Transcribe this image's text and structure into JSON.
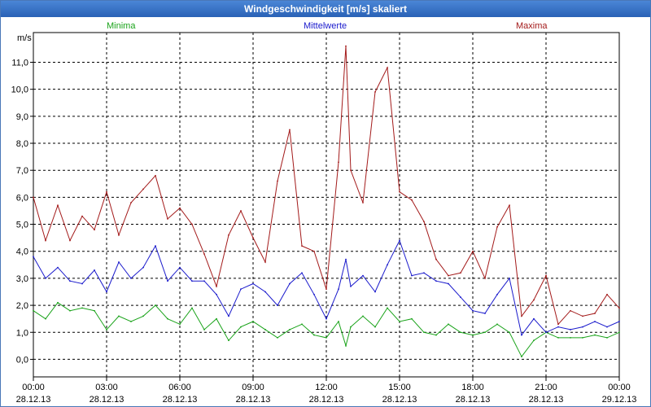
{
  "window": {
    "title": "Windgeschwindigkeit [m/s] skaliert"
  },
  "colors": {
    "minima": "#1aa31a",
    "mittelwerte": "#1a1acc",
    "maxima": "#a31a1a",
    "grid": "#000000"
  },
  "chart_data": {
    "type": "line",
    "title": "Windgeschwindigkeit [m/s] skaliert",
    "ylabel": "m/s",
    "ylim": [
      -0.65,
      12.1
    ],
    "yticks": [
      "0,0",
      "1,0",
      "2,0",
      "3,0",
      "4,0",
      "5,0",
      "6,0",
      "7,0",
      "8,0",
      "9,0",
      "10,0",
      "11,0"
    ],
    "ytick_values": [
      0,
      1,
      2,
      3,
      4,
      5,
      6,
      7,
      8,
      9,
      10,
      11
    ],
    "xlim": [
      0,
      24
    ],
    "xticks": [
      {
        "time": "00:00",
        "date": "28.12.13"
      },
      {
        "time": "03:00",
        "date": "28.12.13"
      },
      {
        "time": "06:00",
        "date": "28.12.13"
      },
      {
        "time": "09:00",
        "date": "28.12.13"
      },
      {
        "time": "12:00",
        "date": "28.12.13"
      },
      {
        "time": "15:00",
        "date": "28.12.13"
      },
      {
        "time": "18:00",
        "date": "28.12.13"
      },
      {
        "time": "21:00",
        "date": "28.12.13"
      },
      {
        "time": "00:00",
        "date": "29.12.13"
      }
    ],
    "grid": true,
    "legend_position": "top",
    "series": [
      {
        "name": "Minima",
        "key": "minima",
        "x": [
          0,
          0.5,
          1,
          1.5,
          2,
          2.5,
          3,
          3.5,
          4,
          4.5,
          5,
          5.5,
          6,
          6.5,
          7,
          7.5,
          8,
          8.5,
          9,
          9.5,
          10,
          10.5,
          11,
          11.5,
          12,
          12.5,
          12.8,
          13,
          13.5,
          14,
          14.5,
          15,
          15.5,
          16,
          16.5,
          17,
          17.5,
          18,
          18.5,
          19,
          19.5,
          20,
          20.5,
          21,
          21.5,
          22,
          22.5,
          23,
          23.5,
          24
        ],
        "values": [
          1.8,
          1.5,
          2.1,
          1.8,
          1.9,
          1.8,
          1.1,
          1.6,
          1.4,
          1.6,
          2.0,
          1.5,
          1.3,
          1.9,
          1.1,
          1.5,
          0.7,
          1.2,
          1.4,
          1.1,
          0.8,
          1.1,
          1.3,
          0.9,
          0.8,
          1.4,
          0.5,
          1.2,
          1.6,
          1.2,
          1.9,
          1.4,
          1.5,
          1.0,
          0.9,
          1.3,
          1.0,
          0.9,
          1.0,
          1.3,
          1.0,
          0.1,
          0.7,
          1.0,
          0.8,
          0.8,
          0.8,
          0.9,
          0.8,
          1.0
        ]
      },
      {
        "name": "Mittelwerte",
        "key": "mittelwerte",
        "x": [
          0,
          0.5,
          1,
          1.5,
          2,
          2.5,
          3,
          3.5,
          4,
          4.5,
          5,
          5.5,
          6,
          6.5,
          7,
          7.5,
          8,
          8.5,
          9,
          9.5,
          10,
          10.5,
          11,
          11.5,
          12,
          12.5,
          12.8,
          13,
          13.5,
          14,
          14.5,
          15,
          15.5,
          16,
          16.5,
          17,
          17.5,
          18,
          18.5,
          19,
          19.5,
          20,
          20.5,
          21,
          21.5,
          22,
          22.5,
          23,
          23.5,
          24
        ],
        "values": [
          3.8,
          3.0,
          3.4,
          2.9,
          2.8,
          3.3,
          2.5,
          3.6,
          3.0,
          3.4,
          4.2,
          2.9,
          3.4,
          2.9,
          2.9,
          2.4,
          1.6,
          2.6,
          2.8,
          2.5,
          2.0,
          2.8,
          3.2,
          2.4,
          1.5,
          2.6,
          3.7,
          2.7,
          3.1,
          2.5,
          3.5,
          4.4,
          3.1,
          3.2,
          2.9,
          2.8,
          2.3,
          1.8,
          1.7,
          2.4,
          3.0,
          0.9,
          1.5,
          1.0,
          1.2,
          1.1,
          1.2,
          1.4,
          1.2,
          1.4
        ]
      },
      {
        "name": "Maxima",
        "key": "maxima",
        "x": [
          0,
          0.5,
          1,
          1.5,
          2,
          2.5,
          3,
          3.5,
          4,
          4.5,
          5,
          5.5,
          6,
          6.5,
          7,
          7.5,
          8,
          8.5,
          9,
          9.5,
          10,
          10.5,
          11,
          11.5,
          12,
          12.5,
          12.8,
          13,
          13.5,
          14,
          14.5,
          15,
          15.5,
          16,
          16.5,
          17,
          17.5,
          18,
          18.5,
          19,
          19.5,
          20,
          20.5,
          21,
          21.5,
          22,
          22.5,
          23,
          23.5,
          24
        ],
        "values": [
          6.0,
          4.4,
          5.7,
          4.4,
          5.3,
          4.8,
          6.2,
          4.6,
          5.8,
          6.3,
          6.8,
          5.2,
          5.6,
          5.0,
          3.9,
          2.7,
          4.6,
          5.5,
          4.5,
          3.6,
          6.6,
          8.5,
          4.2,
          4.0,
          2.6,
          7.3,
          11.6,
          7.0,
          5.8,
          9.9,
          10.8,
          6.2,
          5.9,
          5.1,
          3.7,
          3.1,
          3.2,
          4.0,
          3.0,
          4.9,
          5.7,
          1.6,
          2.2,
          3.1,
          1.3,
          1.8,
          1.6,
          1.7,
          2.4,
          1.9
        ]
      }
    ]
  }
}
